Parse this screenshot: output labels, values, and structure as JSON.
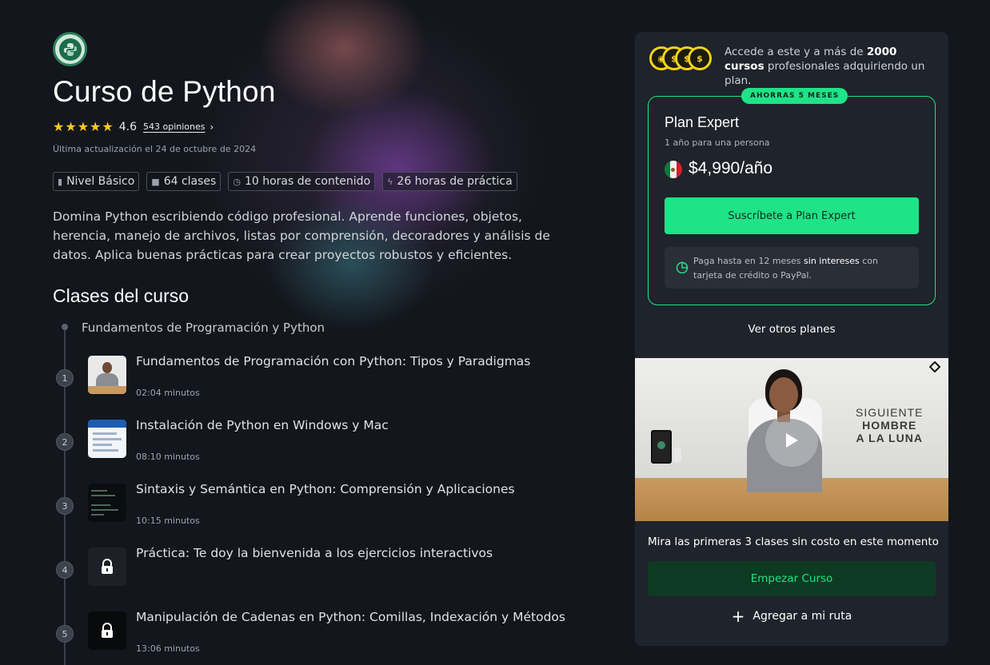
{
  "course": {
    "title": "Curso de Python",
    "rating": "4.6",
    "stars": "★★★★★",
    "reviews": "543 opiniones",
    "updated": "Última actualización el 24 de octubre de 2024",
    "badges": [
      {
        "icon": "level-icon",
        "label": "Nivel Básico"
      },
      {
        "icon": "classes-icon",
        "label": "64 clases"
      },
      {
        "icon": "clock-icon",
        "label": "10 horas de contenido"
      },
      {
        "icon": "bolt-icon",
        "label": "26 horas de práctica"
      }
    ],
    "description": "Domina Python escribiendo código profesional. Aprende funciones, objetos, herencia, manejo de archivos, listas por comprensión, decoradores y análisis de datos. Aplica buenas prácticas para crear proyectos robustos y eficientes."
  },
  "classes": {
    "heading": "Clases del curso",
    "module": "Fundamentos de Programación y Python",
    "lessons": [
      {
        "num": "1",
        "title": "Fundamentos de Programación con Python: Tipos y Paradigmas",
        "duration": "02:04 minutos"
      },
      {
        "num": "2",
        "title": "Instalación de Python en Windows y Mac",
        "duration": "08:10 minutos"
      },
      {
        "num": "3",
        "title": "Sintaxis y Semántica en Python: Comprensión y Aplicaciones",
        "duration": "10:15 minutos"
      },
      {
        "num": "4",
        "title": "Práctica: Te doy la bienvenida a los ejercicios interactivos",
        "duration": ""
      },
      {
        "num": "5",
        "title": "Manipulación de Cadenas en Python: Comillas, Indexación y Métodos",
        "duration": "13:06 minutos"
      }
    ]
  },
  "sidebar": {
    "access_pre": "Accede a este y a más de ",
    "access_bold": "2000 cursos",
    "access_post": " profesionales adquiriendo un plan.",
    "save_pill": "AHORRAS 5 MESES",
    "plan_name": "Plan Expert",
    "plan_sub": "1 año para una persona",
    "price": "$4,990/año",
    "subscribe_label": "Suscríbete a Plan Expert",
    "inst_pre": "Paga hasta en 12 meses ",
    "inst_bold": "sin intereses",
    "inst_post": " con tarjeta de crédito o PayPal.",
    "other_plans": "Ver otros planes",
    "video_text": [
      "SIGUIENTE",
      "HOMBRE",
      "A LA LUNA"
    ],
    "free_text": "Mira las primeras 3 clases sin costo en este momento",
    "start_label": "Empezar Curso",
    "route_label": "Agregar a mi ruta"
  },
  "colors": {
    "accent": "#1fe387",
    "star": "#ffc629",
    "background": "#13161c",
    "card": "#1f232b"
  }
}
